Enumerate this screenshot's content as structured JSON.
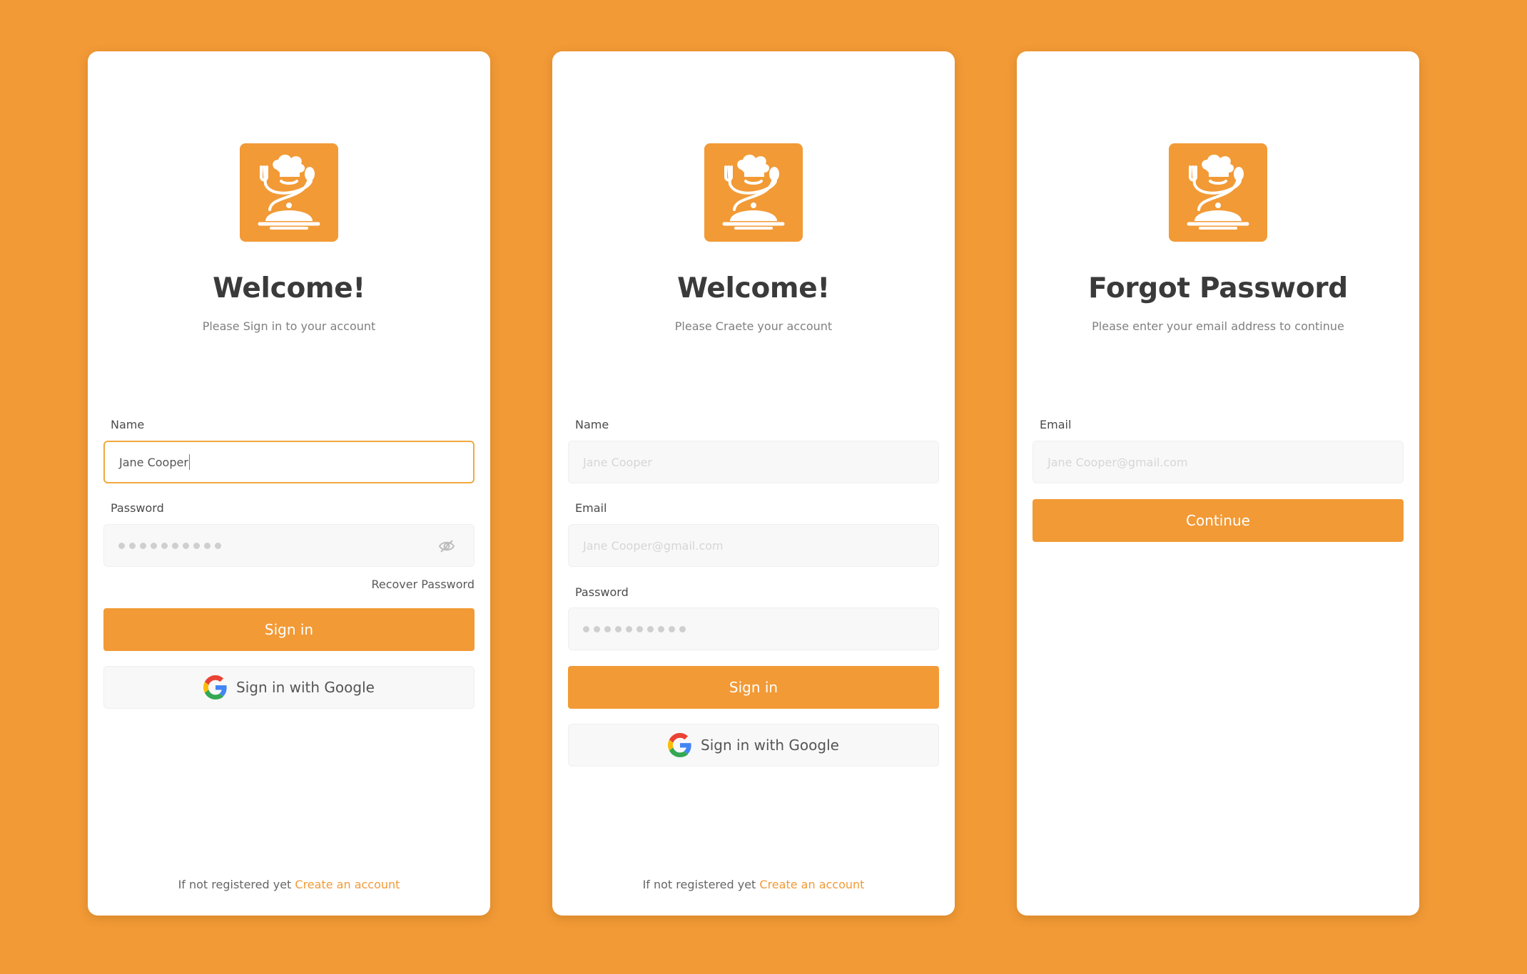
{
  "colors": {
    "accent": "#F29A36",
    "background": "#F29A36",
    "card": "#FFFFFF"
  },
  "signin": {
    "title": "Welcome!",
    "subtitle": "Please Sign in to your account",
    "name_label": "Name",
    "name_value": "Jane Cooper",
    "password_label": "Password",
    "password_icon": "eye-off-icon",
    "recover_link": "Recover Password",
    "sign_in_button": "Sign in",
    "google_button": "Sign in with Google",
    "footer_text": "If not registered yet",
    "footer_link": "Create an account"
  },
  "signup": {
    "title": "Welcome!",
    "subtitle": "Please Craete your account",
    "name_label": "Name",
    "name_placeholder": "Jane Cooper",
    "email_label": "Email",
    "email_placeholder": "Jane Cooper@gmail.com",
    "password_label": "Password",
    "sign_in_button": "Sign in",
    "google_button": "Sign in with Google",
    "footer_text": "If not registered yet",
    "footer_link": "Create an account"
  },
  "forgot": {
    "title": "Forgot Password",
    "subtitle": "Please enter your email address to continue",
    "email_label": "Email",
    "email_placeholder": "Jane Cooper@gmail.com",
    "continue_button": "Continue"
  },
  "icons": {
    "logo": "chef-logo-icon",
    "google": "google-icon"
  }
}
